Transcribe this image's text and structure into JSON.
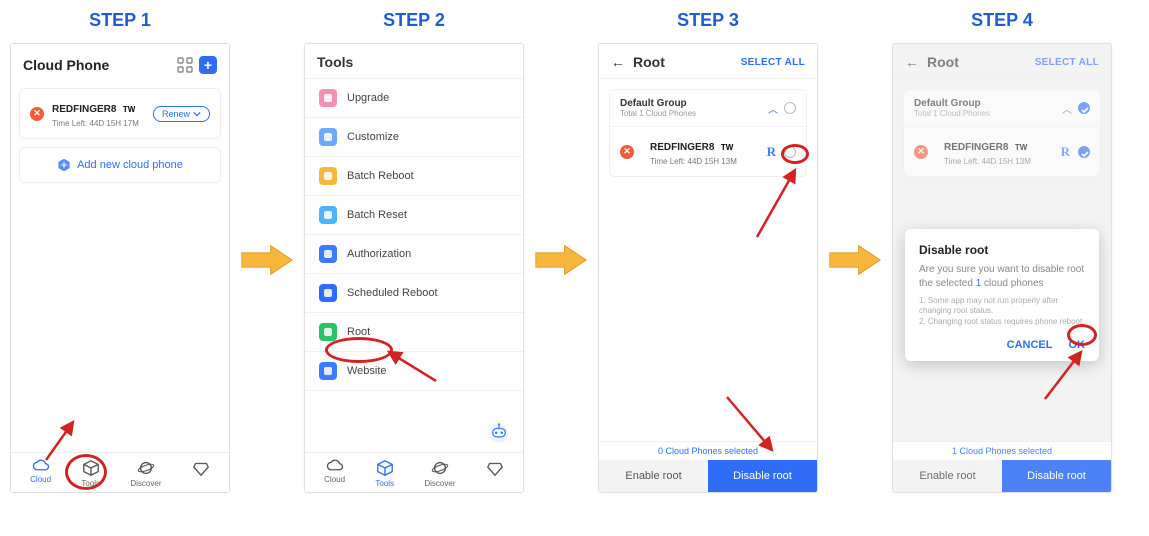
{
  "steps": {
    "s1": {
      "label": "STEP 1"
    },
    "s2": {
      "label": "STEP 2"
    },
    "s3": {
      "label": "STEP 3"
    },
    "s4": {
      "label": "STEP 4"
    }
  },
  "step1": {
    "title": "Cloud Phone",
    "card": {
      "name": "REDFINGER8",
      "tag": "TW",
      "time_left": "Time Left: 44D 15H 17M",
      "renew": "Renew"
    },
    "add_label": "Add new cloud phone",
    "nav": {
      "cloud": "Cloud",
      "tools": "Tools",
      "discover": "Discover",
      "mine": ""
    }
  },
  "step2": {
    "title": "Tools",
    "items": [
      {
        "label": "Upgrade",
        "color": "#f48fb1",
        "dname": "tool-upgrade"
      },
      {
        "label": "Customize",
        "color": "#6fa8ff",
        "dname": "tool-customize"
      },
      {
        "label": "Batch Reboot",
        "color": "#f5b93e",
        "dname": "tool-batch-reboot"
      },
      {
        "label": "Batch Reset",
        "color": "#4db3ff",
        "dname": "tool-batch-reset"
      },
      {
        "label": "Authorization",
        "color": "#3b7bff",
        "dname": "tool-authorization"
      },
      {
        "label": "Scheduled Reboot",
        "color": "#2f6df6",
        "dname": "tool-scheduled-reboot"
      },
      {
        "label": "Root",
        "color": "#28c466",
        "dname": "tool-root"
      },
      {
        "label": "Website",
        "color": "#3b7bff",
        "dname": "tool-website"
      }
    ],
    "nav": {
      "cloud": "Cloud",
      "tools": "Tools",
      "discover": "Discover"
    }
  },
  "step3": {
    "title": "Root",
    "select_all": "SELECT ALL",
    "group": {
      "name": "Default Group",
      "sub": "Total 1 Cloud Phones"
    },
    "device": {
      "name": "REDFINGER8",
      "tag": "TW",
      "time_left": "Time Left: 44D 15H 13M"
    },
    "selected_label_a": "0",
    "selected_label_b": " Cloud Phones selected",
    "enable": "Enable root",
    "disable": "Disable root"
  },
  "step4": {
    "title": "Root",
    "select_all": "SELECT ALL",
    "group": {
      "name": "Default Group",
      "sub": "Total 1 Cloud Phones"
    },
    "device": {
      "name": "REDFINGER8",
      "tag": "TW",
      "time_left": "Time Left: 44D 15H 13M"
    },
    "modal": {
      "title": "Disable root",
      "body_a": "Are you sure you want to disable root the selected ",
      "body_count": "1",
      "body_b": " cloud phones",
      "note1": "1. Some app may not run properly after changing root status.",
      "note2": "2. Changing root status requires phone reboot.",
      "cancel": "CANCEL",
      "ok": "OK"
    },
    "selected_label_a": "1",
    "selected_label_b": " Cloud Phones selected",
    "enable": "Enable root",
    "disable": "Disable root"
  }
}
